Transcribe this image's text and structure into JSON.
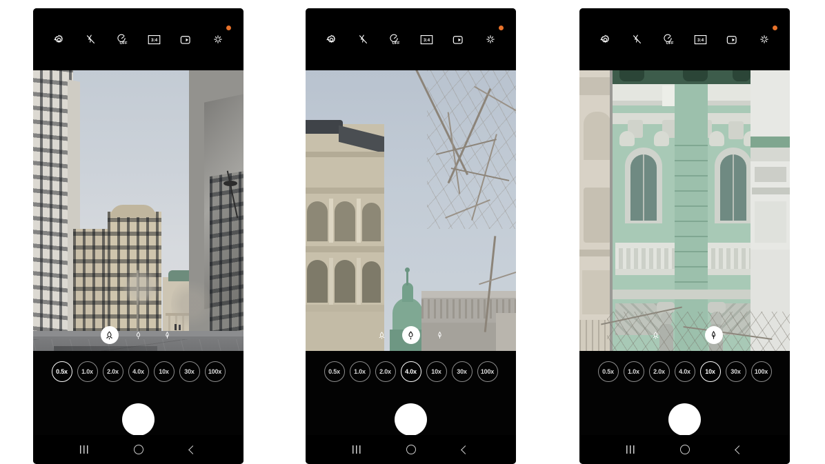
{
  "app": {
    "name": "Camera",
    "platform": "Android"
  },
  "toolbar": {
    "items": [
      {
        "name": "settings-icon",
        "label": "Settings",
        "badge": false
      },
      {
        "name": "flash-off-icon",
        "label": "Flash off",
        "badge": false
      },
      {
        "name": "timer-off-icon",
        "label": "OFF",
        "badge": false
      },
      {
        "name": "aspect-ratio-icon",
        "label": "3:4",
        "badge": false
      },
      {
        "name": "motion-photo-icon",
        "label": "Motion photo",
        "badge": false
      },
      {
        "name": "filters-icon",
        "label": "Filters",
        "badge": true
      }
    ],
    "badge_color": "#e8722a"
  },
  "navbar": {
    "recents_label": "Recents",
    "home_label": "Home",
    "back_label": "Back"
  },
  "shutter": {
    "label": "Shutter",
    "color": "#ffffff"
  },
  "zoom_chips": [
    "0.5x",
    "1.0x",
    "2.0x",
    "4.0x",
    "10x",
    "30x",
    "100x"
  ],
  "lenses": [
    {
      "name": "ultrawide-lens-icon",
      "label": "Ultra wide"
    },
    {
      "name": "wide-lens-icon",
      "label": "Wide"
    },
    {
      "name": "tele-lens-icon",
      "label": "Telephoto"
    }
  ],
  "panels": [
    {
      "id": "phone-1",
      "selected_zoom": "0.5x",
      "selected_zoom_index": 0,
      "selected_lens_index": 0,
      "scene": "Wide city street plaza with buildings on both sides, bare tree, grey paving, overcast sky"
    },
    {
      "id": "phone-2",
      "selected_zoom": "4.0x",
      "selected_zoom_index": 3,
      "selected_lens_index": 1,
      "scene": "Ornate building facade with green copper dome, bare tree branches, overcast sky"
    },
    {
      "id": "phone-3",
      "selected_zoom": "10x",
      "selected_zoom_index": 4,
      "selected_lens_index": 2,
      "scene": "Close-up of mint green ornate building corner with atlas statues and balconies"
    }
  ]
}
